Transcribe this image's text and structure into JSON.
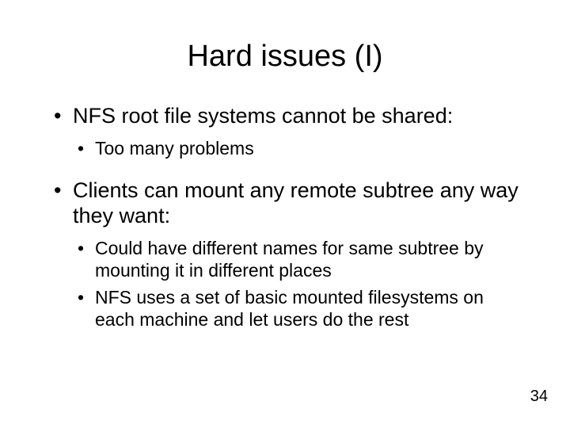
{
  "title": "Hard issues (I)",
  "bullets": [
    {
      "text": "NFS root file systems cannot be shared:",
      "sub": [
        {
          "text": "Too many problems"
        }
      ]
    },
    {
      "text": "Clients can mount any remote subtree any way they want:",
      "sub": [
        {
          "text": "Could have different names for same subtree by mounting it in different places"
        },
        {
          "text": "NFS uses a set of basic mounted filesystems on each machine and let users do the rest"
        }
      ]
    }
  ],
  "page_number": "34"
}
